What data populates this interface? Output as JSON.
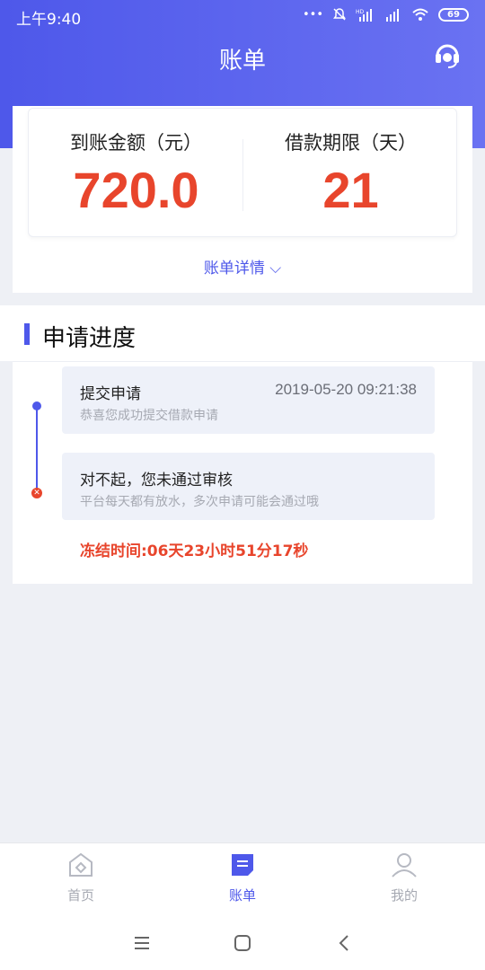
{
  "status_bar": {
    "time": "上午9:40",
    "icons": [
      "more-dots-icon",
      "bell-muted-icon",
      "signal-hd-icon",
      "signal-icon",
      "wifi-icon"
    ],
    "battery": "69"
  },
  "header": {
    "title": "账单",
    "support_icon": "customer-service-icon"
  },
  "summary": {
    "amount_label": "到账金额（元）",
    "amount_value": "720.0",
    "term_label": "借款期限（天）",
    "term_value": "21",
    "detail_link": "账单详情 ⌵"
  },
  "progress": {
    "title": "申请进度",
    "steps": [
      {
        "title": "提交申请",
        "desc": "恭喜您成功提交借款申请",
        "time": "2019-05-20 09:21:38",
        "status": "done"
      },
      {
        "title": "对不起，您未通过审核",
        "desc": "平台每天都有放水，多次申请可能会通过哦",
        "status": "rejected"
      }
    ],
    "freeze_text": "冻结时间:06天23小时51分17秒"
  },
  "tabs": [
    {
      "label": "首页",
      "icon": "home-icon",
      "active": false
    },
    {
      "label": "账单",
      "icon": "bill-icon",
      "active": true
    },
    {
      "label": "我的",
      "icon": "profile-icon",
      "active": false
    }
  ],
  "colors": {
    "accent": "#4e58ea",
    "danger": "#e8452c"
  }
}
